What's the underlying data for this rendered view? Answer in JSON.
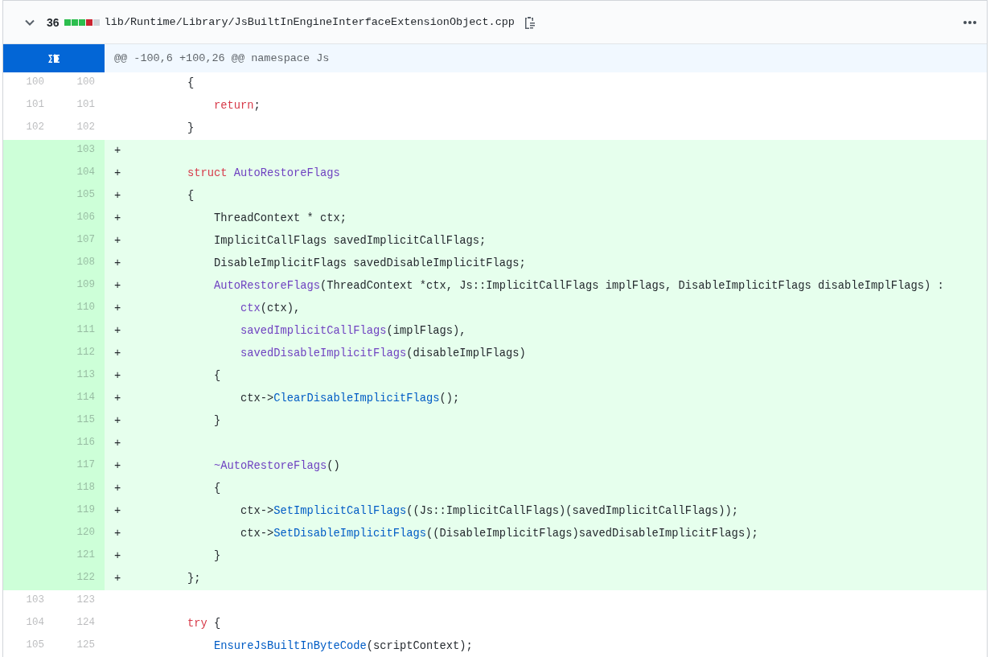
{
  "file_header": {
    "expanded": true,
    "changes": "36",
    "diffstat": [
      {
        "color": "#2cbe4e"
      },
      {
        "color": "#2cbe4e"
      },
      {
        "color": "#2cbe4e"
      },
      {
        "color": "#cb2431"
      },
      {
        "color": "#d1d5da"
      }
    ],
    "path": "lib/Runtime/Library/JsBuiltInEngineInterfaceExtensionObject.cpp"
  },
  "hunk": {
    "header": "@@ -100,6 +100,26 @@ namespace Js"
  },
  "rows": [
    {
      "kind": "context",
      "old": "100",
      "new": "100",
      "tokens": [
        {
          "kind": "plain",
          "text": "        {"
        }
      ]
    },
    {
      "kind": "context",
      "old": "101",
      "new": "101",
      "tokens": [
        {
          "kind": "keyword",
          "text": "            return"
        },
        {
          "kind": "plain",
          "text": ";"
        }
      ]
    },
    {
      "kind": "context",
      "old": "102",
      "new": "102",
      "tokens": [
        {
          "kind": "plain",
          "text": "        }"
        }
      ]
    },
    {
      "kind": "addition",
      "new": "103",
      "marker": "+",
      "tokens": []
    },
    {
      "kind": "addition",
      "new": "104",
      "marker": "+",
      "tokens": [
        {
          "kind": "keyword",
          "text": "        struct "
        },
        {
          "kind": "entity",
          "text": "AutoRestoreFlags"
        }
      ]
    },
    {
      "kind": "addition",
      "new": "105",
      "marker": "+",
      "tokens": [
        {
          "kind": "plain",
          "text": "        {"
        }
      ]
    },
    {
      "kind": "addition",
      "new": "106",
      "marker": "+",
      "tokens": [
        {
          "kind": "plain",
          "text": "            ThreadContext * ctx;"
        }
      ]
    },
    {
      "kind": "addition",
      "new": "107",
      "marker": "+",
      "tokens": [
        {
          "kind": "plain",
          "text": "            ImplicitCallFlags savedImplicitCallFlags;"
        }
      ]
    },
    {
      "kind": "addition",
      "new": "108",
      "marker": "+",
      "tokens": [
        {
          "kind": "plain",
          "text": "            DisableImplicitFlags savedDisableImplicitFlags;"
        }
      ]
    },
    {
      "kind": "addition",
      "new": "109",
      "marker": "+",
      "tokens": [
        {
          "kind": "entity",
          "text": "            AutoRestoreFlags"
        },
        {
          "kind": "plain",
          "text": "(ThreadContext *ctx, Js::ImplicitCallFlags implFlags, DisableImplicitFlags disableImplFlags) :"
        }
      ]
    },
    {
      "kind": "addition",
      "new": "110",
      "marker": "+",
      "tokens": [
        {
          "kind": "entity",
          "text": "                ctx"
        },
        {
          "kind": "plain",
          "text": "(ctx),"
        }
      ]
    },
    {
      "kind": "addition",
      "new": "111",
      "marker": "+",
      "tokens": [
        {
          "kind": "entity",
          "text": "                savedImplicitCallFlags"
        },
        {
          "kind": "plain",
          "text": "(implFlags),"
        }
      ]
    },
    {
      "kind": "addition",
      "new": "112",
      "marker": "+",
      "tokens": [
        {
          "kind": "entity",
          "text": "                savedDisableImplicitFlags"
        },
        {
          "kind": "plain",
          "text": "(disableImplFlags)"
        }
      ]
    },
    {
      "kind": "addition",
      "new": "113",
      "marker": "+",
      "tokens": [
        {
          "kind": "plain",
          "text": "            {"
        }
      ]
    },
    {
      "kind": "addition",
      "new": "114",
      "marker": "+",
      "tokens": [
        {
          "kind": "plain",
          "text": "                ctx->"
        },
        {
          "kind": "func",
          "text": "ClearDisableImplicitFlags"
        },
        {
          "kind": "plain",
          "text": "();"
        }
      ]
    },
    {
      "kind": "addition",
      "new": "115",
      "marker": "+",
      "tokens": [
        {
          "kind": "plain",
          "text": "            }"
        }
      ]
    },
    {
      "kind": "addition",
      "new": "116",
      "marker": "+",
      "tokens": []
    },
    {
      "kind": "addition",
      "new": "117",
      "marker": "+",
      "tokens": [
        {
          "kind": "entity",
          "text": "            ~AutoRestoreFlags"
        },
        {
          "kind": "plain",
          "text": "()"
        }
      ]
    },
    {
      "kind": "addition",
      "new": "118",
      "marker": "+",
      "tokens": [
        {
          "kind": "plain",
          "text": "            {"
        }
      ]
    },
    {
      "kind": "addition",
      "new": "119",
      "marker": "+",
      "tokens": [
        {
          "kind": "plain",
          "text": "                ctx->"
        },
        {
          "kind": "func",
          "text": "SetImplicitCallFlags"
        },
        {
          "kind": "plain",
          "text": "((Js::ImplicitCallFlags)(savedImplicitCallFlags));"
        }
      ]
    },
    {
      "kind": "addition",
      "new": "120",
      "marker": "+",
      "tokens": [
        {
          "kind": "plain",
          "text": "                ctx->"
        },
        {
          "kind": "func",
          "text": "SetDisableImplicitFlags"
        },
        {
          "kind": "plain",
          "text": "((DisableImplicitFlags)savedDisableImplicitFlags);"
        }
      ]
    },
    {
      "kind": "addition",
      "new": "121",
      "marker": "+",
      "tokens": [
        {
          "kind": "plain",
          "text": "            }"
        }
      ]
    },
    {
      "kind": "addition",
      "new": "122",
      "marker": "+",
      "tokens": [
        {
          "kind": "plain",
          "text": "        };"
        }
      ]
    },
    {
      "kind": "context",
      "old": "103",
      "new": "123",
      "tokens": []
    },
    {
      "kind": "context",
      "old": "104",
      "new": "124",
      "tokens": [
        {
          "kind": "keyword",
          "text": "        try"
        },
        {
          "kind": "plain",
          "text": " {"
        }
      ]
    },
    {
      "kind": "context",
      "old": "105",
      "new": "125",
      "tokens": [
        {
          "kind": "func",
          "text": "            EnsureJsBuiltInByteCode"
        },
        {
          "kind": "plain",
          "text": "(scriptContext);"
        }
      ]
    }
  ]
}
